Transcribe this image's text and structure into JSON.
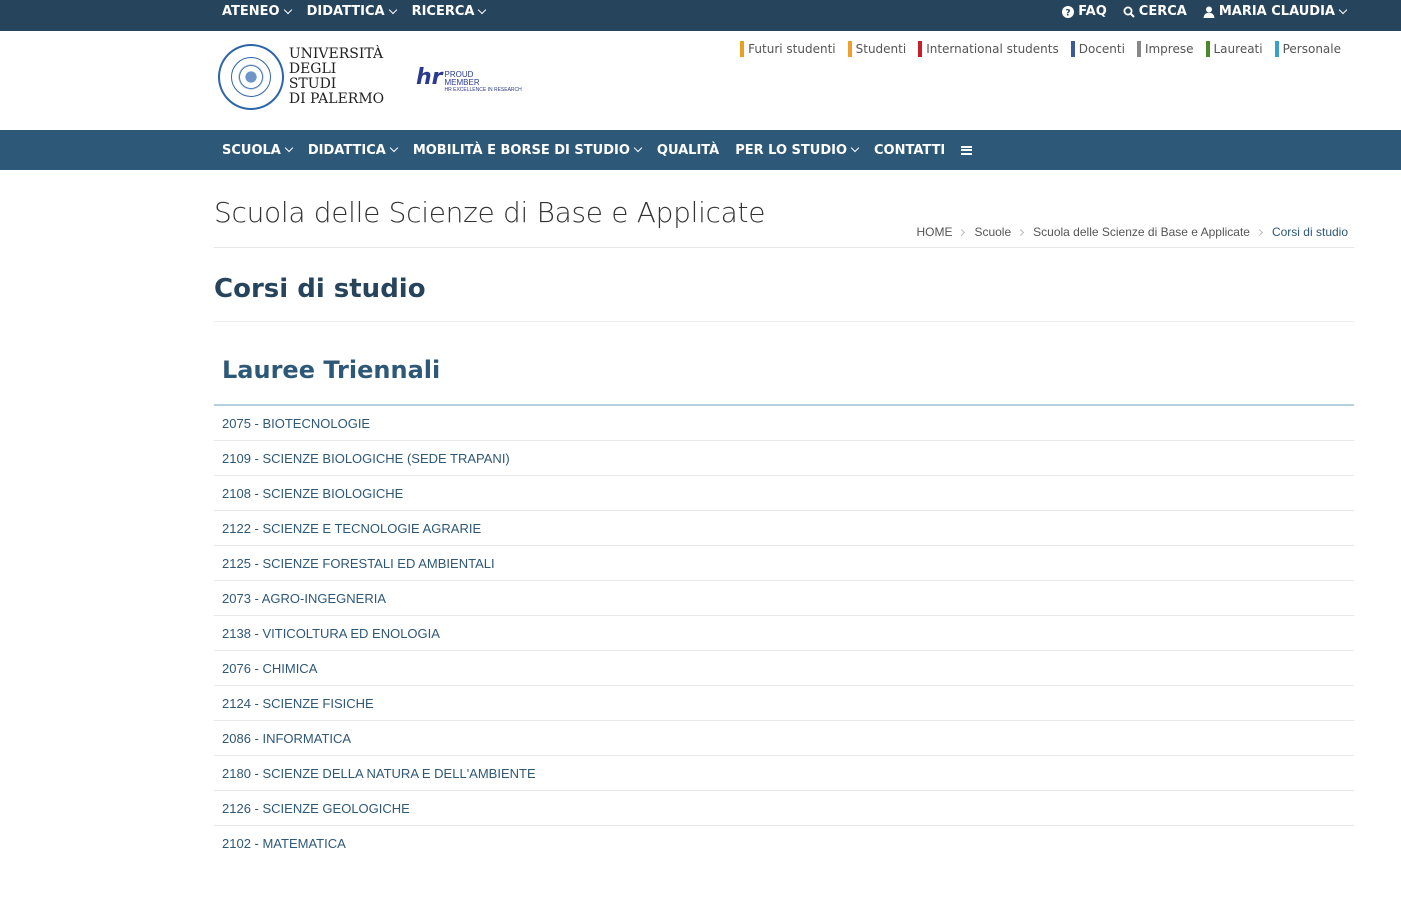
{
  "topbar": {
    "left_items": [
      {
        "label": "ATENEO"
      },
      {
        "label": "DIDATTICA"
      },
      {
        "label": "RICERCA"
      }
    ],
    "faq": "FAQ",
    "search": "CERCA",
    "user": "MARIA CLAUDIA"
  },
  "header": {
    "logo_line1": "UNIVERSITÀ",
    "logo_line2": "DEGLI STUDI",
    "logo_line3": "DI PALERMO",
    "hr_line1": "PROUD",
    "hr_line2": "MEMBER",
    "hr_line3": "HR EXCELLENCE IN RESEARCH",
    "audience": [
      {
        "label": "Futuri studenti",
        "color": "#e8a020"
      },
      {
        "label": "Studenti",
        "color": "#f0a030"
      },
      {
        "label": "International students",
        "color": "#c81e28"
      },
      {
        "label": "Docenti",
        "color": "#3a5a98"
      },
      {
        "label": "Imprese",
        "color": "#888888"
      },
      {
        "label": "Laureati",
        "color": "#4a8a2a"
      },
      {
        "label": "Personale",
        "color": "#3aa0c8"
      }
    ]
  },
  "nav": {
    "items": [
      {
        "label": "SCUOLA",
        "dropdown": true
      },
      {
        "label": "DIDATTICA",
        "dropdown": true
      },
      {
        "label": "MOBILITÀ E BORSE DI STUDIO",
        "dropdown": true
      },
      {
        "label": "QUALITÀ",
        "dropdown": false
      },
      {
        "label": "PER LO STUDIO",
        "dropdown": true
      },
      {
        "label": "CONTATTI",
        "dropdown": false
      }
    ]
  },
  "page": {
    "title": "Scuola delle Scienze di Base e Applicate",
    "breadcrumb": [
      "HOME",
      "Scuole",
      "Scuola delle Scienze di Base e Applicate",
      "Corsi di studio"
    ],
    "section_title": "Corsi di studio",
    "list_title": "Lauree Triennali",
    "courses": [
      "2075 - BIOTECNOLOGIE",
      "2109 - SCIENZE BIOLOGICHE (SEDE TRAPANI)",
      "2108 - SCIENZE BIOLOGICHE",
      "2122 - SCIENZE E TECNOLOGIE AGRARIE",
      "2125 - SCIENZE FORESTALI ED AMBIENTALI",
      "2073 - AGRO-INGEGNERIA",
      "2138 - VITICOLTURA ED ENOLOGIA",
      "2076 - CHIMICA",
      "2124 - SCIENZE FISICHE",
      "2086 - INFORMATICA",
      "2180 - SCIENZE DELLA NATURA E DELL'AMBIENTE",
      "2126 - SCIENZE GEOLOGICHE",
      "2102 - MATEMATICA"
    ]
  }
}
